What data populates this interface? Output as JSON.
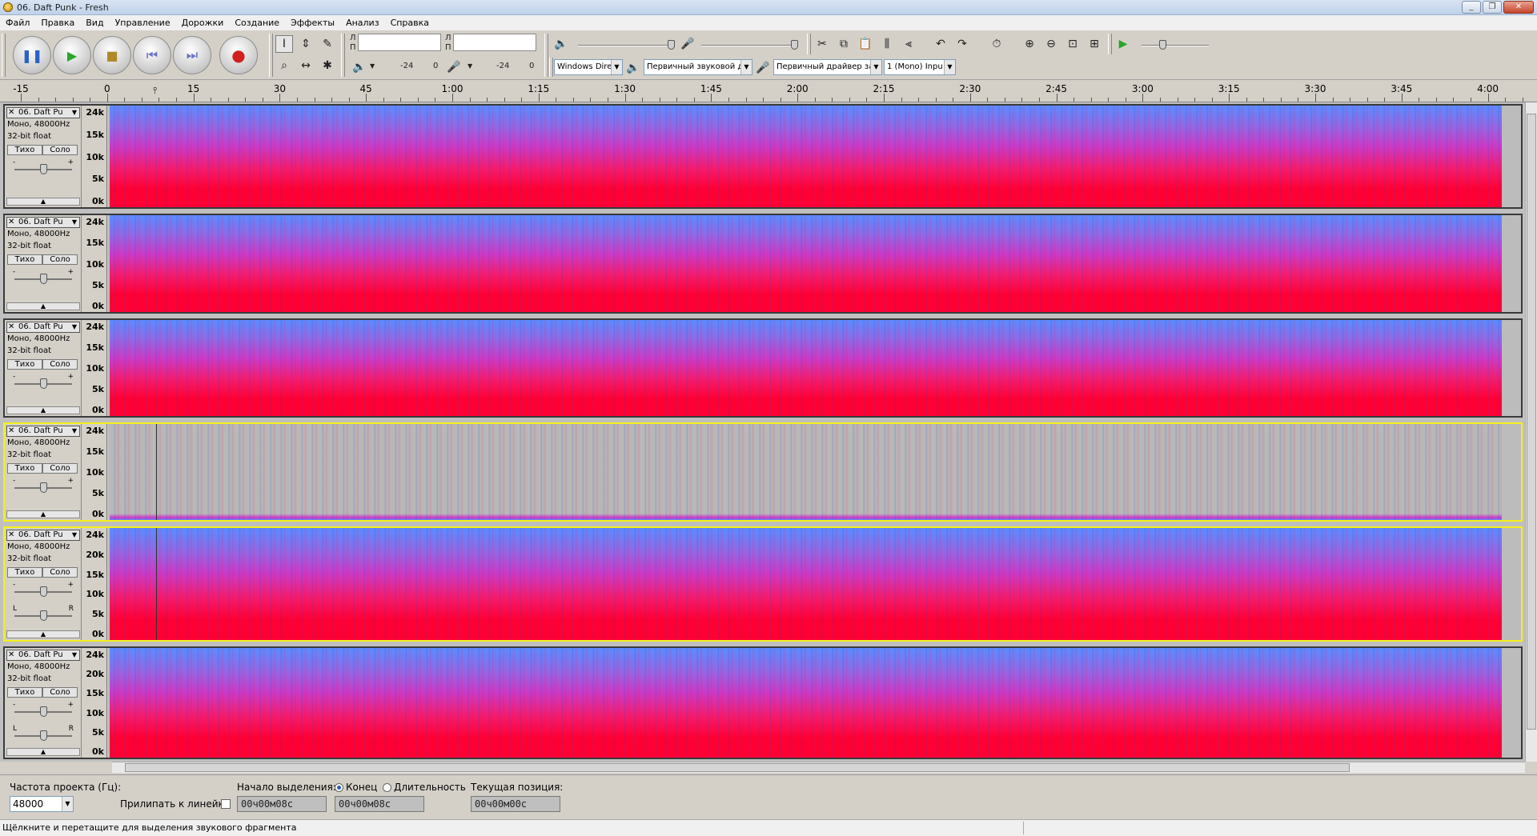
{
  "window": {
    "title": "06. Daft Punk - Fresh",
    "buttons": [
      "_",
      "❐",
      "✕"
    ]
  },
  "menu": [
    "Файл",
    "Правка",
    "Вид",
    "Управление",
    "Дорожки",
    "Создание",
    "Эффекты",
    "Анализ",
    "Справка"
  ],
  "meters": {
    "play_L": "Л",
    "play_R": "П",
    "rec_L": "Л",
    "rec_R": "П",
    "left_db": "-24",
    "left_zero": "0",
    "right_db": "-24",
    "right_zero": "0"
  },
  "device": {
    "host": "Windows Dire",
    "output": "Первичный звуковой д",
    "input": "Первичный драйвер за",
    "channels": "1 (Mono) Inpu"
  },
  "ruler": {
    "labels": [
      "-15",
      "0",
      "15",
      "30",
      "45",
      "1:00",
      "1:15",
      "1:30",
      "1:45",
      "2:00",
      "2:15",
      "2:30",
      "2:45",
      "3:00",
      "3:15",
      "3:30",
      "3:45",
      "4:00"
    ]
  },
  "tracks": [
    {
      "name": "06. Daft Pu",
      "format": "Моно, 48000Hz",
      "bits": "32-bit float",
      "mute": "Тихо",
      "solo": "Соло",
      "freq": [
        "24k",
        "15k",
        "10k",
        "5k",
        "0k"
      ],
      "selected": false,
      "signal": true
    },
    {
      "name": "06. Daft Pu",
      "format": "Моно, 48000Hz",
      "bits": "32-bit float",
      "mute": "Тихо",
      "solo": "Соло",
      "freq": [
        "24k",
        "15k",
        "10k",
        "5k",
        "0k"
      ],
      "selected": false,
      "signal": true
    },
    {
      "name": "06. Daft Pu",
      "format": "Моно, 48000Hz",
      "bits": "32-bit float",
      "mute": "Тихо",
      "solo": "Соло",
      "freq": [
        "24k",
        "15k",
        "10k",
        "5k",
        "0k"
      ],
      "selected": false,
      "signal": true
    },
    {
      "name": "06. Daft Pu",
      "format": "Моно, 48000Hz",
      "bits": "32-bit float",
      "mute": "Тихо",
      "solo": "Соло",
      "freq": [
        "24k",
        "15k",
        "10k",
        "5k",
        "0k"
      ],
      "selected": true,
      "signal": false
    },
    {
      "name": "06. Daft Pu",
      "format": "Моно, 48000Hz",
      "bits": "32-bit float",
      "mute": "Тихо",
      "solo": "Соло",
      "freq": [
        "24k",
        "20k",
        "15k",
        "10k",
        "5k",
        "0k"
      ],
      "selected": true,
      "signal": true
    },
    {
      "name": "06. Daft Pu",
      "format": "Моно, 48000Hz",
      "bits": "32-bit float",
      "mute": "Тихо",
      "solo": "Соло",
      "freq": [
        "24k",
        "20k",
        "15k",
        "10k",
        "5k",
        "0k"
      ],
      "selected": false,
      "signal": true
    }
  ],
  "selection": {
    "rate_label": "Частота проекта (Гц):",
    "rate_value": "48000",
    "snap_label": "Прилипать к линейке",
    "start_label": "Начало выделения:",
    "end_radio": "Конец",
    "length_radio": "Длительность",
    "position_label": "Текущая позиция:",
    "start_value": "00ч00м08с",
    "end_value": "00ч00м08с",
    "position_value": "00ч00м00с"
  },
  "status": "Щёлкните и перетащите для выделения звукового фрагмента",
  "colors": {
    "spec_low": "#ff0033",
    "spec_mid": "#c83cc8",
    "spec_high": "#5a8cff",
    "selected_border": "#f4f01a"
  }
}
